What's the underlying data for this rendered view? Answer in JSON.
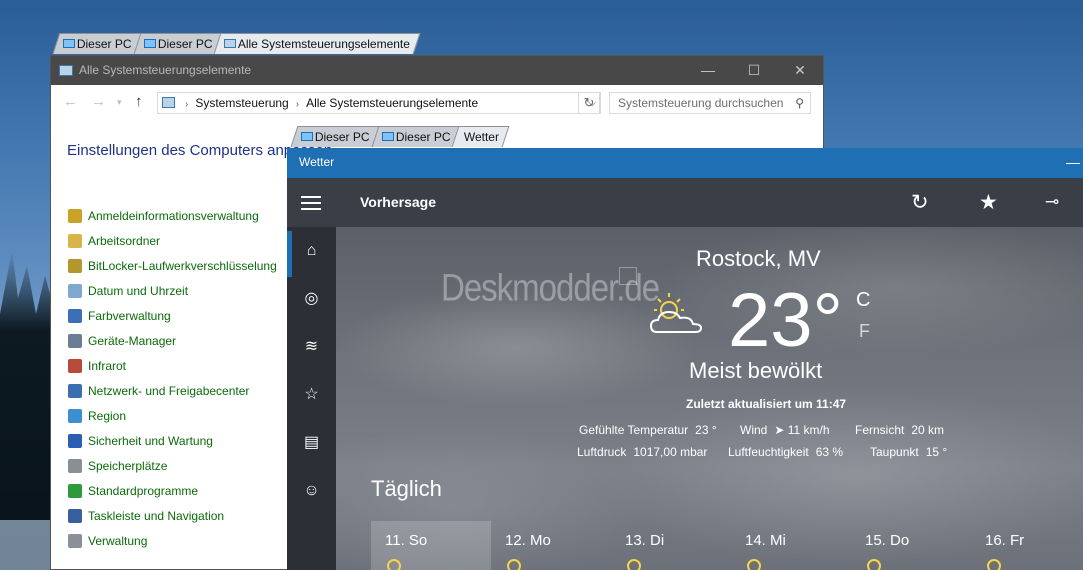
{
  "explorer_tabs_back": [
    "Dieser PC",
    "Dieser PC",
    "Alle Systemsteuerungselemente"
  ],
  "control_panel": {
    "title": "Alle Systemsteuerungselemente",
    "breadcrumb": [
      "Systemsteuerung",
      "Alle Systemsteuerungselemente"
    ],
    "search_placeholder": "Systemsteuerung durchsuchen",
    "heading": "Einstellungen des Computers anpassen",
    "items": [
      {
        "label": "Anmeldeinformationsverwaltung",
        "icon": "vault-icon",
        "color": "#c9a227"
      },
      {
        "label": "Arbeitsordner",
        "icon": "folder-icon",
        "color": "#d7b54a"
      },
      {
        "label": "BitLocker-Laufwerkverschlüsselung",
        "icon": "key-icon",
        "color": "#b3962d"
      },
      {
        "label": "Datum und Uhrzeit",
        "icon": "clock-icon",
        "color": "#7fa8d0"
      },
      {
        "label": "Farbverwaltung",
        "icon": "monitor-icon",
        "color": "#3b6fb6"
      },
      {
        "label": "Geräte-Manager",
        "icon": "device-manager-icon",
        "color": "#6a7f95"
      },
      {
        "label": "Infrarot",
        "icon": "infrared-icon",
        "color": "#b84a3a"
      },
      {
        "label": "Netzwerk- und Freigabecenter",
        "icon": "network-icon",
        "color": "#3a6fb0"
      },
      {
        "label": "Region",
        "icon": "globe-icon",
        "color": "#3f8fd0"
      },
      {
        "label": "Sicherheit und Wartung",
        "icon": "flag-icon",
        "color": "#2a5fb2"
      },
      {
        "label": "Speicherplätze",
        "icon": "storage-icon",
        "color": "#8a8f96"
      },
      {
        "label": "Standardprogramme",
        "icon": "default-programs-icon",
        "color": "#2e9a3a"
      },
      {
        "label": "Taskleiste und Navigation",
        "icon": "taskbar-icon",
        "color": "#3a5fa0"
      },
      {
        "label": "Verwaltung",
        "icon": "admin-tools-icon",
        "color": "#8a9099"
      }
    ]
  },
  "explorer_tabs_front": [
    "Dieser PC",
    "Dieser PC",
    "Wetter"
  ],
  "weather": {
    "window_title": "Wetter",
    "appbar_title": "Vorhersage",
    "watermark": "Deskmodder.de",
    "city": "Rostock, MV",
    "temperature": "23°",
    "unit_c": "C",
    "unit_f": "F",
    "condition": "Meist bewölkt",
    "updated": "Zuletzt aktualisiert um 11:47",
    "details_row1": [
      {
        "label": "Gefühlte Temperatur",
        "value": "23 °"
      },
      {
        "label": "Wind",
        "value": "➤ 11 km/h"
      },
      {
        "label": "Fernsicht",
        "value": "20 km"
      }
    ],
    "details_row2": [
      {
        "label": "Luftdruck",
        "value": "1017,00 mbar"
      },
      {
        "label": "Luftfeuchtigkeit",
        "value": "63 %"
      },
      {
        "label": "Taupunkt",
        "value": "15 °"
      }
    ],
    "daily_heading": "Täglich",
    "days": [
      "11. So",
      "12. Mo",
      "13. Di",
      "14. Mi",
      "15. Do",
      "16. Fr"
    ],
    "sun_color": "#f7d34a",
    "accent": "#1f6fb4"
  }
}
